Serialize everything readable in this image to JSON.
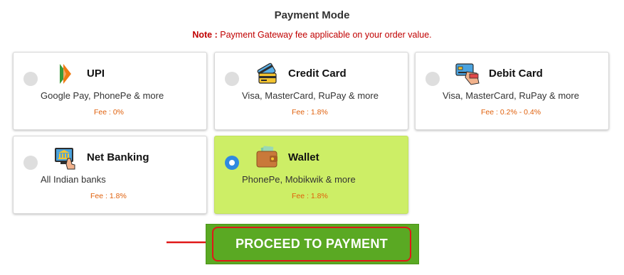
{
  "header": {
    "title": "Payment Mode",
    "note_label": "Note :",
    "note_text": " Payment Gateway fee applicable on your order value."
  },
  "payment_options": [
    {
      "name": "UPI",
      "description": "Google Pay, PhonePe & more",
      "fee": "Fee : 0%",
      "selected": false,
      "icon": "upi-logo-icon"
    },
    {
      "name": "Credit Card",
      "description": "Visa, MasterCard, RuPay & more",
      "fee": "Fee : 1.8%",
      "selected": false,
      "icon": "credit-card-icon"
    },
    {
      "name": "Debit Card",
      "description": "Visa, MasterCard, RuPay & more",
      "fee": "Fee : 0.2% - 0.4%",
      "selected": false,
      "icon": "debit-card-icon"
    },
    {
      "name": "Net Banking",
      "description": "All Indian banks",
      "fee": "Fee : 1.8%",
      "selected": false,
      "icon": "net-banking-icon"
    },
    {
      "name": "Wallet",
      "description": "PhonePe, Mobikwik & more",
      "fee": "Fee : 1.8%",
      "selected": true,
      "icon": "wallet-icon"
    }
  ],
  "proceed_button": {
    "label": "PROCEED TO PAYMENT"
  },
  "colors": {
    "selected_card": "#cdee66",
    "radio_selected": "#2f8ae0",
    "fee_text": "#e0600c",
    "note_text": "#c00000",
    "proceed_bg": "#5aa923",
    "highlight": "#e01818"
  }
}
